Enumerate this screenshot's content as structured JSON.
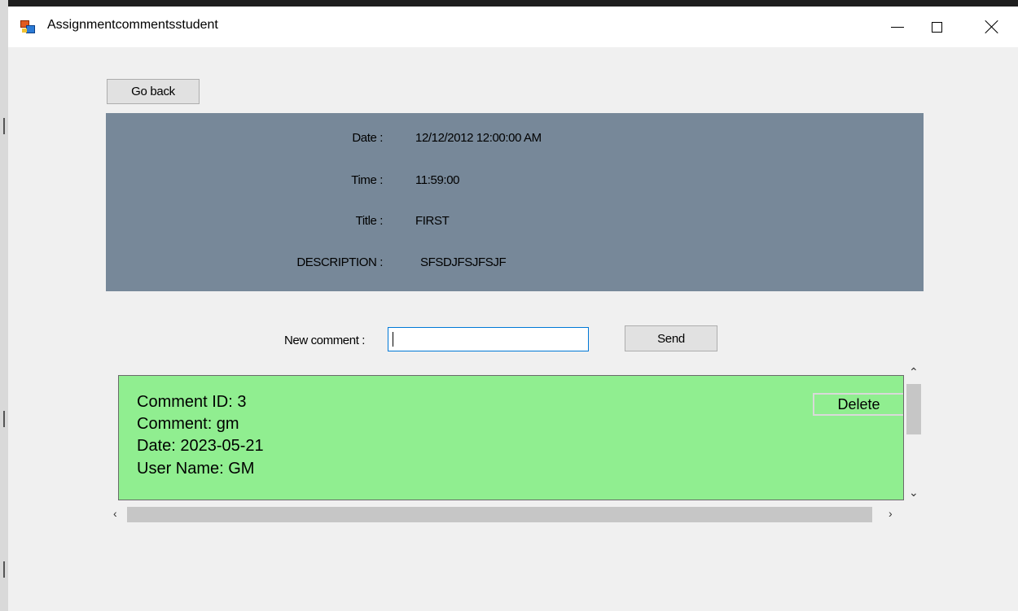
{
  "window": {
    "title": "Assignmentcommentsstudent",
    "icon": "winforms-app-icon",
    "controls": {
      "minimize": "minimize-icon",
      "maximize": "maximize-icon",
      "close": "close-icon"
    }
  },
  "toolbar": {
    "go_back_label": "Go back"
  },
  "assignment": {
    "date_label": "Date :",
    "date_value": "12/12/2012 12:00:00 AM",
    "time_label": "Time :",
    "time_value": "11:59:00",
    "title_label": "Title :",
    "title_value": "FIRST",
    "description_label": "DESCRIPTION :",
    "description_value": "SFSDJFSJFSJF",
    "panel_color": "#778899"
  },
  "new_comment": {
    "label": "New comment :",
    "value": "",
    "send_label": "Send"
  },
  "comments": [
    {
      "id_line": "Comment ID: 3",
      "comment_line": "Comment: gm",
      "date_line": "Date: 2023-05-21",
      "user_line": "User Name: GM",
      "delete_label": "Delete",
      "card_color": "#90ee90"
    }
  ],
  "scrollbars": {
    "up": "chevron-up-icon",
    "down": "chevron-down-icon",
    "left": "chevron-left-icon",
    "right": "chevron-right-icon"
  }
}
